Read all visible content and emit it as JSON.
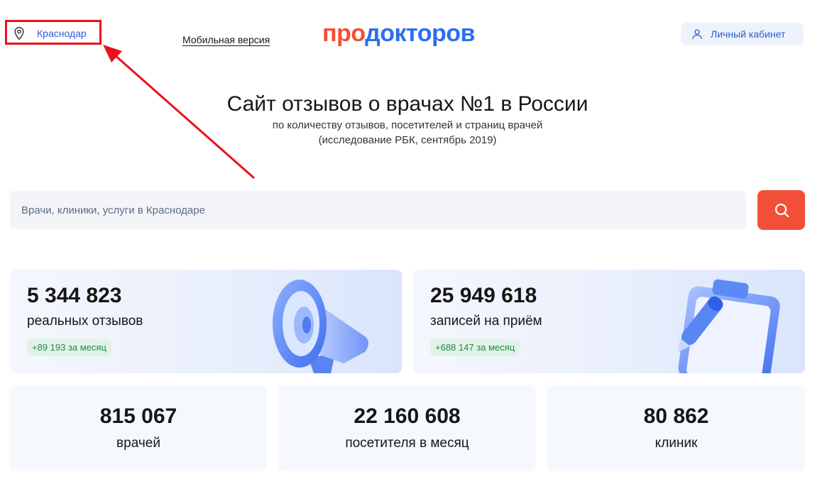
{
  "header": {
    "city": "Краснодар",
    "mobile_link": "Мобильная версия",
    "logo_part1": "про",
    "logo_part2": "докторов",
    "account_label": "Личный кабинет"
  },
  "hero": {
    "title": "Сайт отзывов о врачах №1 в России",
    "subtitle_line1": "по количеству отзывов, посетителей и страниц врачей",
    "subtitle_line2": "(исследование РБК, сентябрь 2019)"
  },
  "search": {
    "placeholder": "Врачи, клиники, услуги в Краснодаре"
  },
  "stats_big": [
    {
      "number": "5 344 823",
      "caption": "реальных отзывов",
      "delta": "+89 193 за месяц",
      "illustration": "megaphone-icon"
    },
    {
      "number": "25 949 618",
      "caption": "записей на приём",
      "delta": "+688 147 за месяц",
      "illustration": "clipboard-pen-icon"
    }
  ],
  "stats_small": [
    {
      "number": "815 067",
      "caption": "врачей"
    },
    {
      "number": "22 160 608",
      "caption": "посетителя в месяц"
    },
    {
      "number": "80 862",
      "caption": "клиник"
    }
  ],
  "colors": {
    "brand_red": "#f24f38",
    "brand_blue": "#2b6ef2",
    "link_blue": "#2b5cd6",
    "annotation_red": "#e8121a",
    "delta_green": "#1e8a4a"
  }
}
